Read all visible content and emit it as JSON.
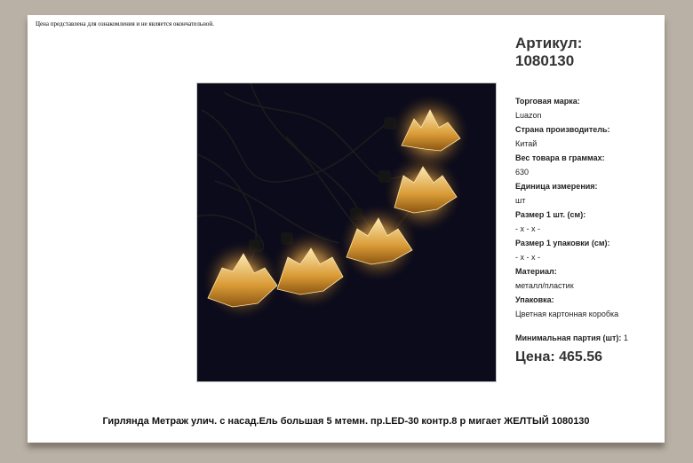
{
  "disclaimer": "Цена представлена для ознакомления и не является окончательной.",
  "article": {
    "label": "Артикул:",
    "number": "1080130"
  },
  "specs": [
    {
      "label": "Торговая марка:",
      "value": "Luazon"
    },
    {
      "label": "Страна производитель:",
      "value": "Китай"
    },
    {
      "label": "Вес товара в граммах:",
      "value": "630"
    },
    {
      "label": "Единица измерения:",
      "value": "шт"
    },
    {
      "label": "Размер 1 шт. (см):",
      "value": "- х - х -"
    },
    {
      "label": "Размер 1 упаковки (см):",
      "value": "- х - х -"
    },
    {
      "label": "Материал:",
      "value": "металл/пластик"
    },
    {
      "label": "Упаковка:",
      "value": "Цветная картонная коробка"
    }
  ],
  "min_batch": {
    "label": "Минимальная партия (шт):",
    "value": "1"
  },
  "price": "Цена: 465.56",
  "product_title": "Гирлянда Метраж улич. с насад.Ель большая 5 мтемн. пр.LED-30 контр.8 р мигает ЖЕЛТЫЙ 1080130",
  "colors": {
    "background": "#b9b0a6",
    "glow": "#f5c35a"
  }
}
